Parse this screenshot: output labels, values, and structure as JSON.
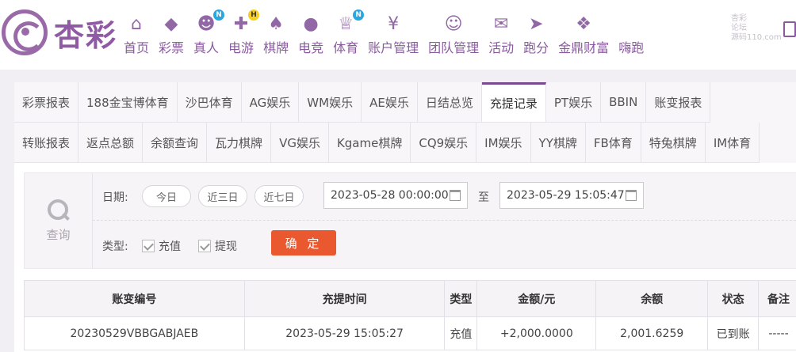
{
  "brand": {
    "name": "杏彩"
  },
  "nav": [
    {
      "label": "首页",
      "icon": "home-icon",
      "badge": ""
    },
    {
      "label": "彩票",
      "icon": "lottery-ticket-icon",
      "badge": ""
    },
    {
      "label": "真人",
      "icon": "live-dealer-icon",
      "badge": "N"
    },
    {
      "label": "电游",
      "icon": "gamepad-icon",
      "badge": "H"
    },
    {
      "label": "棋牌",
      "icon": "cards-icon",
      "badge": ""
    },
    {
      "label": "电竞",
      "icon": "esports-controller-icon",
      "badge": ""
    },
    {
      "label": "体育",
      "icon": "trophy-icon",
      "badge": "N"
    },
    {
      "label": "账户管理",
      "icon": "account-yen-icon",
      "badge": ""
    },
    {
      "label": "团队管理",
      "icon": "team-icon",
      "badge": ""
    },
    {
      "label": "活动",
      "icon": "gift-icon",
      "badge": ""
    },
    {
      "label": "跑分",
      "icon": "running-shoe-icon",
      "badge": ""
    },
    {
      "label": "金鼎财富",
      "icon": "wealth-icon",
      "badge": ""
    },
    {
      "label": "嗨跑",
      "icon": "run-icon",
      "badge": ""
    }
  ],
  "watermark": {
    "line1": "杏彩",
    "line2": "论坛",
    "line3": "源码110.com"
  },
  "tabs_row1": [
    "彩票报表",
    "188金宝博体育",
    "沙巴体育",
    "AG娱乐",
    "WM娱乐",
    "AE娱乐",
    "日结总览",
    "充提记录",
    "PT娱乐",
    "BBIN",
    "账变报表"
  ],
  "tabs_row2": [
    "转账报表",
    "返点总额",
    "余额查询",
    "瓦力棋牌",
    "VG娱乐",
    "Kgame棋牌",
    "CQ9娱乐",
    "IM娱乐",
    "YY棋牌",
    "FB体育",
    "特兔棋牌",
    "IM体育"
  ],
  "active_tab": "充提记录",
  "filter": {
    "search_label": "查询",
    "date_label": "日期:",
    "quick_dates": [
      "今日",
      "近三日",
      "近七日"
    ],
    "start": "2023-05-28 00:00:00",
    "to": "至",
    "end": "2023-05-29 15:05:47",
    "type_label": "类型:",
    "types": [
      "充值",
      "提现"
    ],
    "confirm": "确 定"
  },
  "table": {
    "headers": [
      "账变编号",
      "充提时间",
      "类型",
      "金额/元",
      "余额",
      "状态",
      "备注"
    ],
    "rows": [
      [
        "20230529VBBGABJAEB",
        "2023-05-29 15:05:27",
        "充值",
        "+2,000.0000",
        "2,001.6259",
        "已到账",
        "-----"
      ]
    ]
  },
  "colors": {
    "brand": "#8f5aa3",
    "active_tab": "#7a4a90",
    "confirm": "#e9582e",
    "amount": "#d3302f",
    "status_ok": "#3a9e3a"
  }
}
